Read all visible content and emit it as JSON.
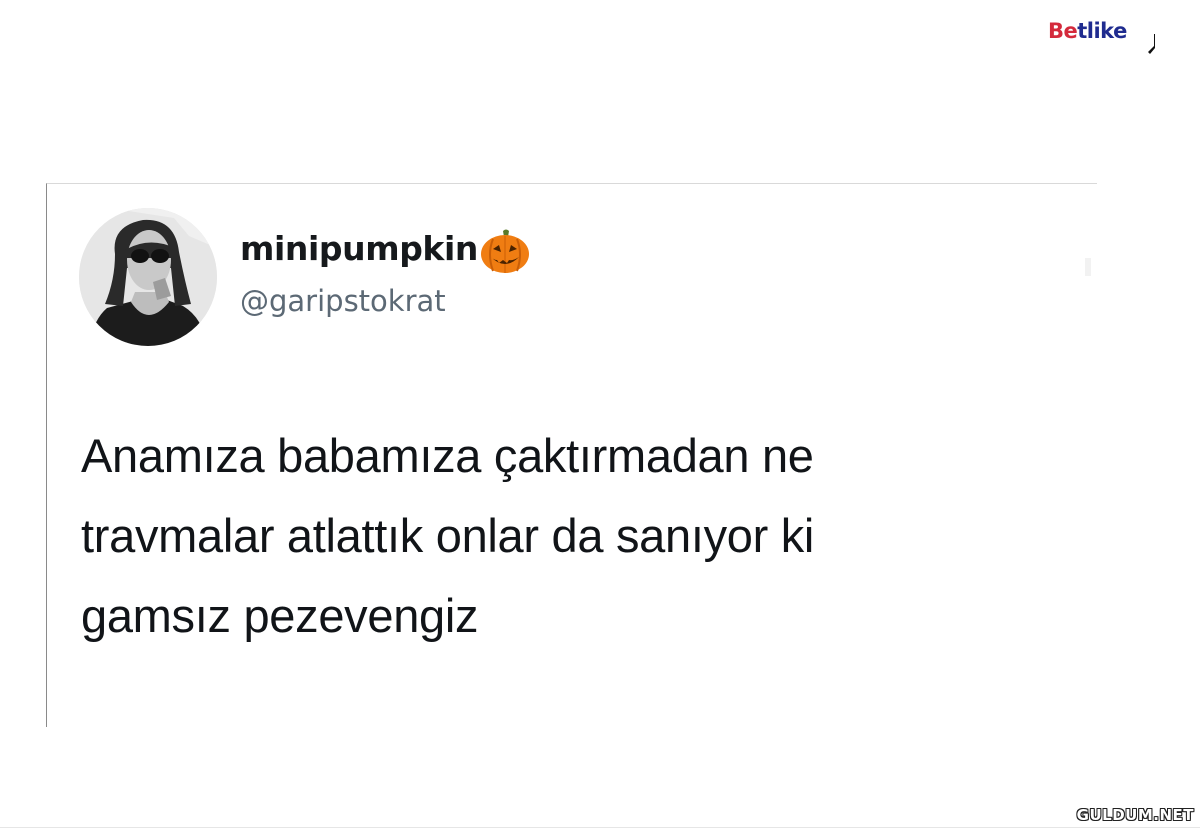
{
  "brand": {
    "part1": "Be",
    "part2": "tlike",
    "color_primary": "#d42a3c",
    "color_secondary": "#1f2b8f"
  },
  "tweet": {
    "display_name": "minipumpkin",
    "badge_icon": "jack-o-lantern-icon",
    "username": "@garipstokrat",
    "text_lines": [
      "Anamıza babamıza çaktırmadan ne",
      "travmalar atlattık onlar da sanıyor ki",
      "gamsız pezevengiz"
    ],
    "avatar": "profile-photo"
  },
  "watermark": {
    "text": "GULDUM.NET"
  },
  "colors": {
    "name": "#16191c",
    "handle": "#5c6975",
    "body_text": "#111418",
    "pumpkin": "#f07d12"
  }
}
